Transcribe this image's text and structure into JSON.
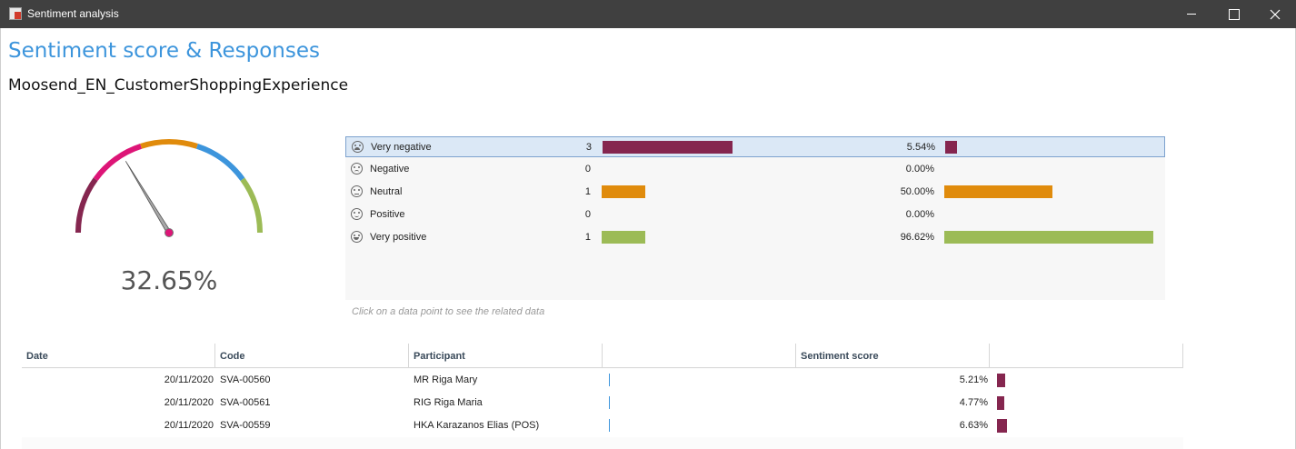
{
  "window": {
    "title": "Sentiment analysis"
  },
  "header": {
    "title": "Sentiment score & Responses",
    "survey_name": "Moosend_EN_CustomerShoppingExperience"
  },
  "gauge": {
    "value_label": "32.65%",
    "value": 32.65,
    "segment_colors": [
      "#85264f",
      "#dd1577",
      "#e08b0c",
      "#3d95dc",
      "#9cbb56"
    ]
  },
  "distribution": [
    {
      "label": "Very negative",
      "count": "3",
      "count_value": 3,
      "percent": "5.54%",
      "percent_value": 5.54,
      "color": "#85264f",
      "selected": true,
      "icon": "very-negative-face-icon"
    },
    {
      "label": "Negative",
      "count": "0",
      "count_value": 0,
      "percent": "0.00%",
      "percent_value": 0,
      "color": "#dd1577",
      "selected": false,
      "icon": "negative-face-icon"
    },
    {
      "label": "Neutral",
      "count": "1",
      "count_value": 1,
      "percent": "50.00%",
      "percent_value": 50,
      "color": "#e08b0c",
      "selected": false,
      "icon": "neutral-face-icon"
    },
    {
      "label": "Positive",
      "count": "0",
      "count_value": 0,
      "percent": "0.00%",
      "percent_value": 0,
      "color": "#3d95dc",
      "selected": false,
      "icon": "positive-face-icon"
    },
    {
      "label": "Very positive",
      "count": "1",
      "count_value": 1,
      "percent": "96.62%",
      "percent_value": 96.62,
      "color": "#9cbb56",
      "selected": false,
      "icon": "very-positive-face-icon"
    }
  ],
  "hint": "Click on a data point to see the related data",
  "table": {
    "columns": [
      "Date",
      "Code",
      "Participant",
      "",
      "Sentiment score",
      ""
    ],
    "rows": [
      {
        "date": "20/11/2020",
        "code": "SVA-00560",
        "participant": "MR Riga Mary",
        "score": "5.21%",
        "score_value": 5.21
      },
      {
        "date": "20/11/2020",
        "code": "SVA-00561",
        "participant": "RIG Riga Maria",
        "score": "4.77%",
        "score_value": 4.77
      },
      {
        "date": "20/11/2020",
        "code": "SVA-00559",
        "participant": "HKA Karazanos Elias (POS)",
        "score": "6.63%",
        "score_value": 6.63
      }
    ]
  }
}
